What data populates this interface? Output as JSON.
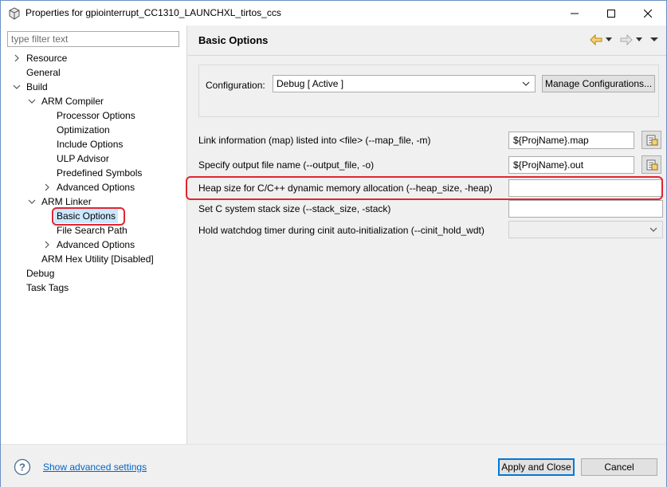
{
  "window": {
    "title": "Properties for gpiointerrupt_CC1310_LAUNCHXL_tirtos_ccs"
  },
  "filter": {
    "placeholder": "type filter text",
    "value": ""
  },
  "tree": [
    {
      "label": "Resource"
    },
    {
      "label": "General"
    },
    {
      "label": "Build"
    },
    {
      "label": "ARM Compiler"
    },
    {
      "label": "Processor Options"
    },
    {
      "label": "Optimization"
    },
    {
      "label": "Include Options"
    },
    {
      "label": "ULP Advisor"
    },
    {
      "label": "Predefined Symbols"
    },
    {
      "label": "Advanced Options"
    },
    {
      "label": "ARM Linker"
    },
    {
      "label": "Basic Options"
    },
    {
      "label": "File Search Path"
    },
    {
      "label": "Advanced Options"
    },
    {
      "label": "ARM Hex Utility  [Disabled]"
    },
    {
      "label": "Debug"
    },
    {
      "label": "Task Tags"
    }
  ],
  "page": {
    "title": "Basic Options"
  },
  "config": {
    "label": "Configuration:",
    "value": "Debug  [ Active ]",
    "manage_button": "Manage Configurations..."
  },
  "options": [
    {
      "label": "Link information (map) listed into <file> (--map_file, -m)",
      "value": "${ProjName}.map"
    },
    {
      "label": "Specify output file name (--output_file, -o)",
      "value": "${ProjName}.out"
    },
    {
      "label": "Heap size for C/C++ dynamic memory allocation (--heap_size, -heap)",
      "value": ""
    },
    {
      "label": "Set C system stack size (--stack_size, -stack)",
      "value": ""
    },
    {
      "label": "Hold watchdog timer during cinit auto-initialization (--cinit_hold_wdt)",
      "value": ""
    }
  ],
  "footer": {
    "advanced_link": "Show advanced settings",
    "apply_button": "Apply and Close",
    "cancel_button": "Cancel"
  },
  "colors": {
    "highlight_outline": "#e0262f",
    "selection": "#cce8ff",
    "link": "#0066cc",
    "focus": "#0078d7"
  }
}
